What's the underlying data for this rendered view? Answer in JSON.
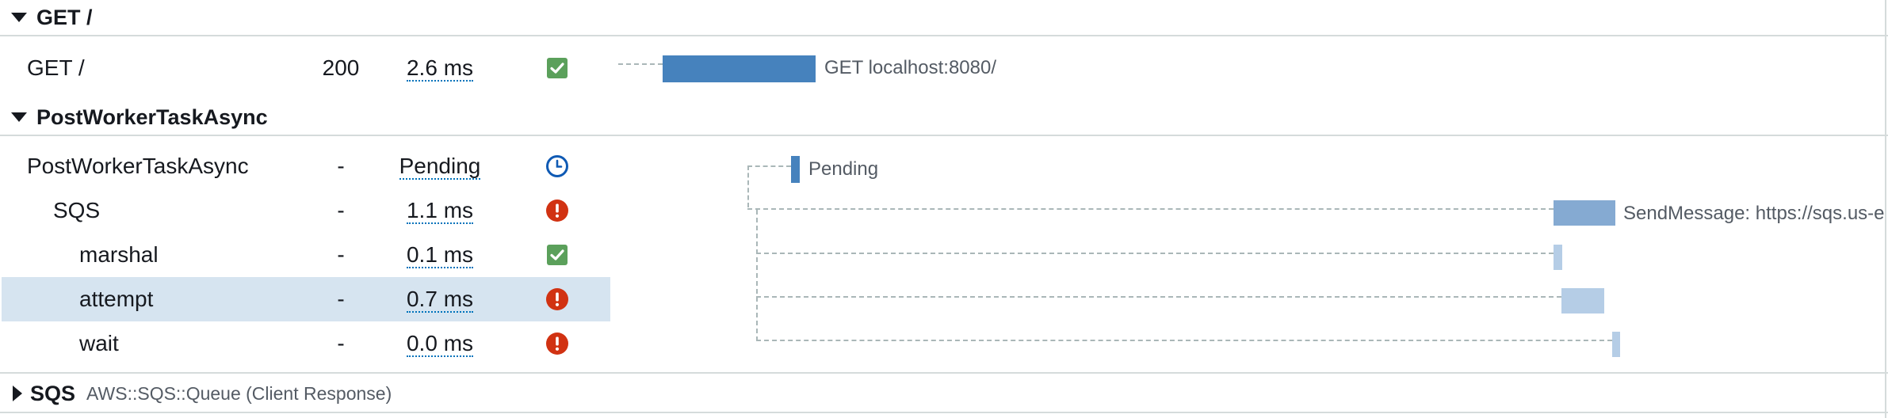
{
  "groups": [
    {
      "title": "GET /",
      "expanded": true,
      "rows": [
        {
          "name": "GET /",
          "status": "200",
          "duration": "2.6 ms",
          "state_icon": "check-icon",
          "bar_label": "GET localhost:8080/"
        }
      ]
    },
    {
      "title": "PostWorkerTaskAsync",
      "expanded": true,
      "rows": [
        {
          "name": "PostWorkerTaskAsync",
          "status": "-",
          "duration": "Pending",
          "state_icon": "clock-icon",
          "bar_label": "Pending"
        },
        {
          "name": "SQS",
          "status": "-",
          "duration": "1.1 ms",
          "state_icon": "error-icon",
          "bar_label": "SendMessage: https://sqs.us-e"
        },
        {
          "name": "marshal",
          "status": "-",
          "duration": "0.1 ms",
          "state_icon": "check-icon",
          "bar_label": ""
        },
        {
          "name": "attempt",
          "status": "-",
          "duration": "0.7 ms",
          "state_icon": "error-icon",
          "bar_label": "",
          "selected": true
        },
        {
          "name": "wait",
          "status": "-",
          "duration": "0.0 ms",
          "state_icon": "error-icon",
          "bar_label": ""
        }
      ]
    },
    {
      "title": "SQS",
      "subtitle": "AWS::SQS::Queue (Client Response)",
      "expanded": false
    }
  ],
  "colors": {
    "ok": "#5ba05b",
    "error": "#d13212",
    "pending": "#0f5ab4",
    "bar_primary": "#4682bd",
    "bar_mid": "#85aad2",
    "bar_light": "#b5cde6",
    "selected_row": "#d6e4f0"
  }
}
